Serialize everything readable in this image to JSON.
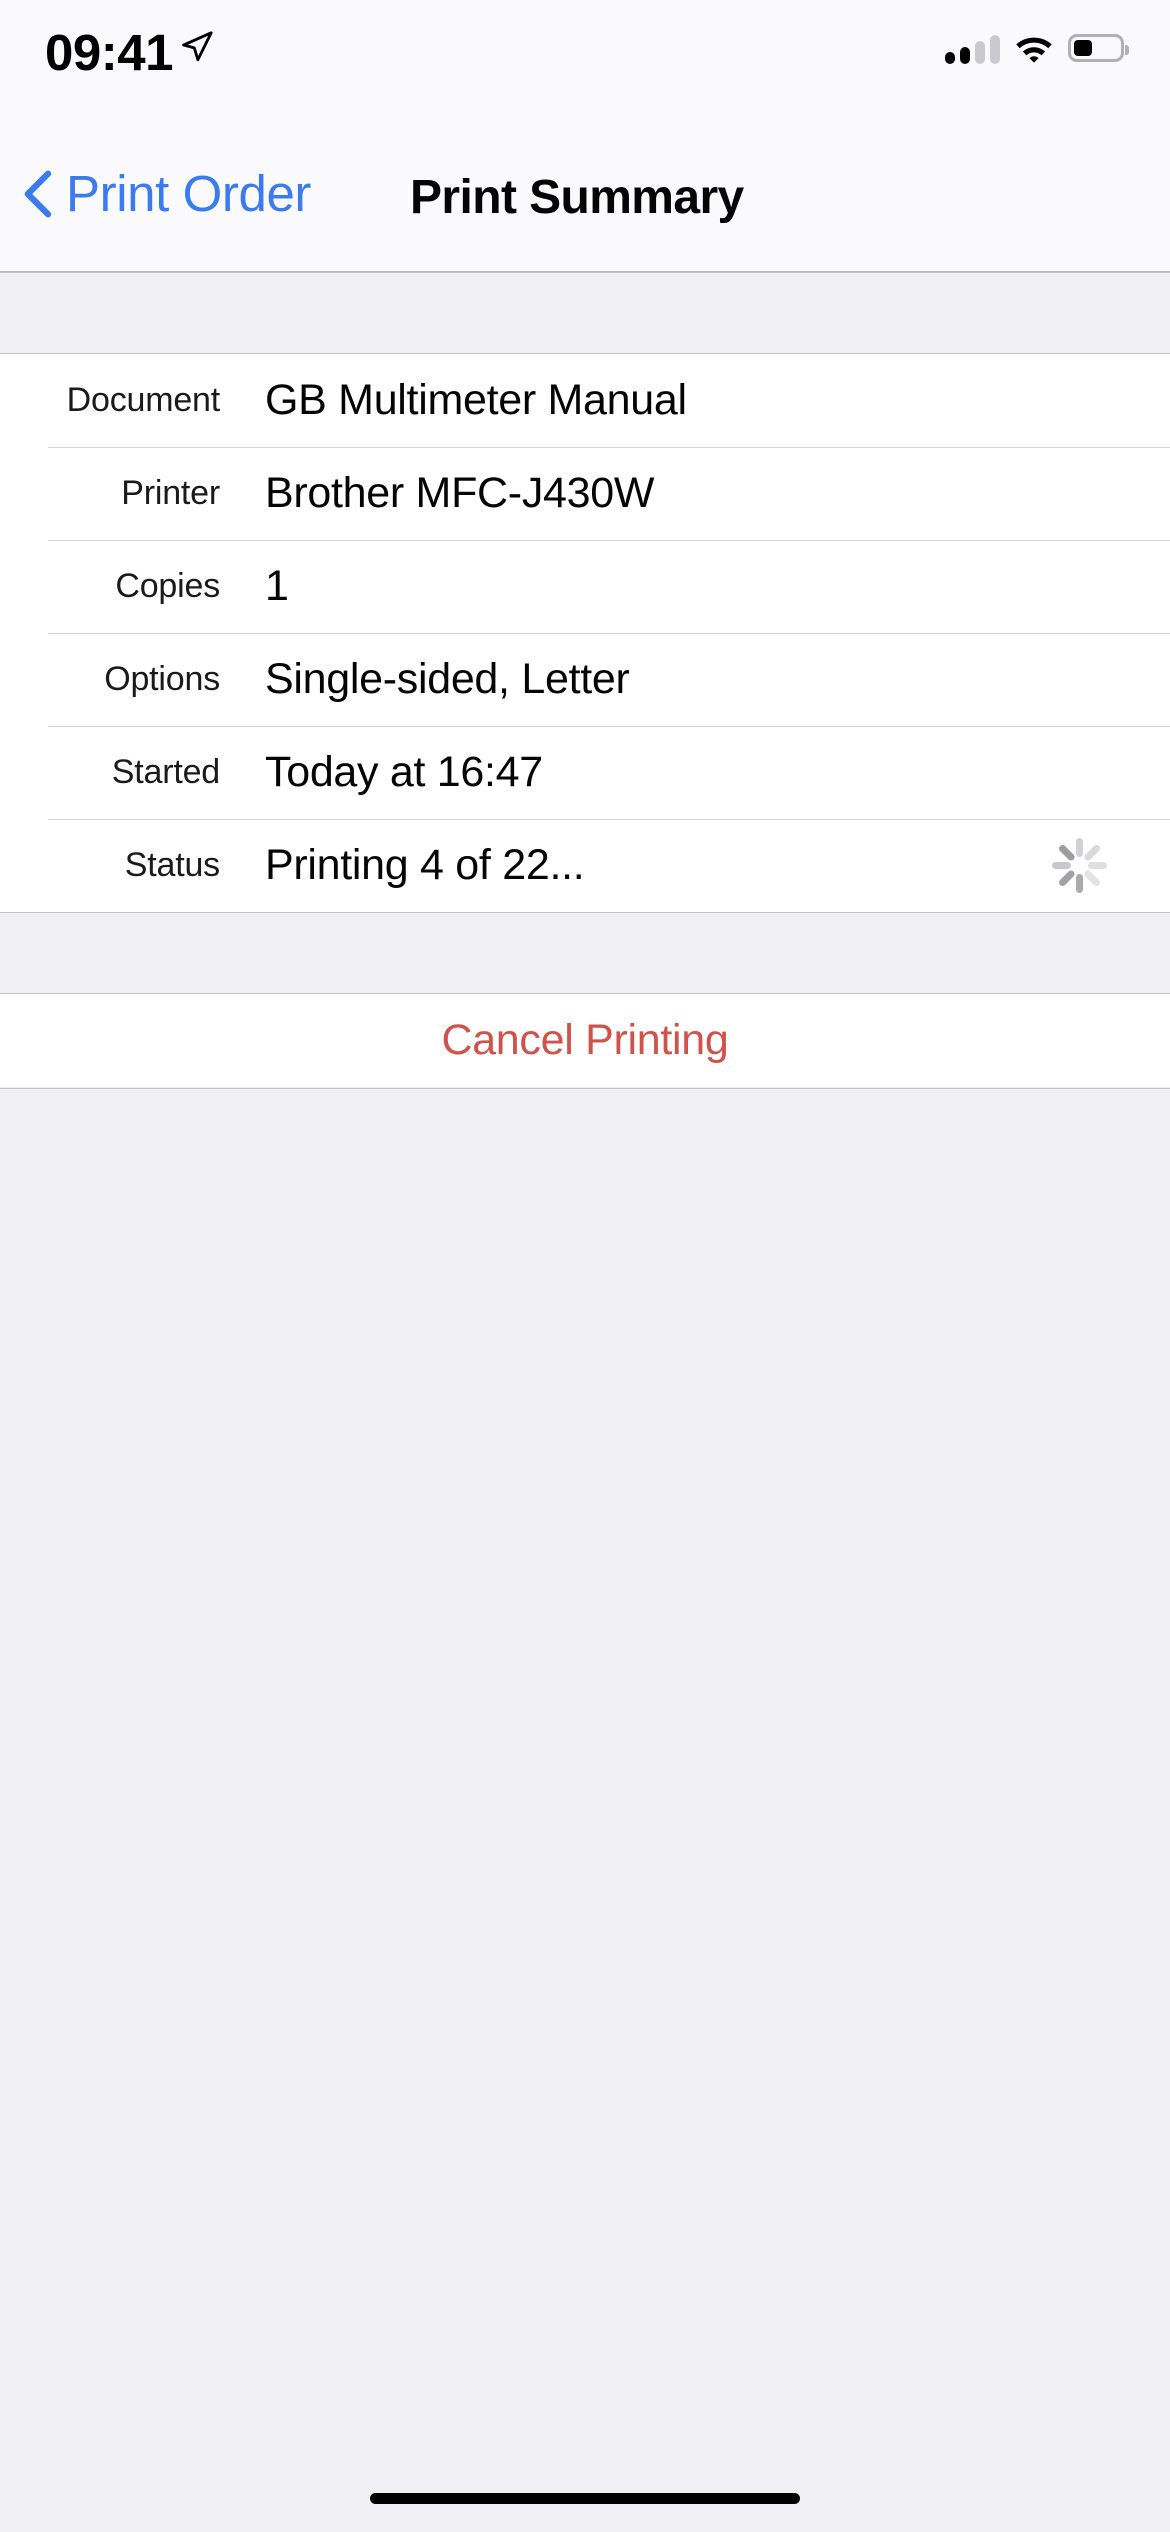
{
  "status_bar": {
    "time": "09:41",
    "location_icon": "location-arrow-icon",
    "signal_icon": "cellular-signal-icon",
    "signal_bars_total": 4,
    "signal_bars_active": 2,
    "wifi_icon": "wifi-icon",
    "battery_icon": "battery-icon",
    "battery_percent": 35
  },
  "nav_bar": {
    "back_label": "Print Order",
    "back_icon": "chevron-left-icon",
    "title": "Print Summary",
    "accent_color": "#3B7BEF"
  },
  "summary": {
    "rows": [
      {
        "label": "Document",
        "value": "GB Multimeter Manual"
      },
      {
        "label": "Printer",
        "value": "Brother MFC-J430W"
      },
      {
        "label": "Copies",
        "value": "1"
      },
      {
        "label": "Options",
        "value": "Single-sided, Letter"
      },
      {
        "label": "Started",
        "value": "Today at 16:47"
      },
      {
        "label": "Status",
        "value": "Printing 4 of 22...",
        "accessory": "activity-spinner"
      }
    ]
  },
  "actions": {
    "cancel_label": "Cancel Printing",
    "destructive_color": "#CE544B"
  },
  "home_indicator": "home-indicator"
}
